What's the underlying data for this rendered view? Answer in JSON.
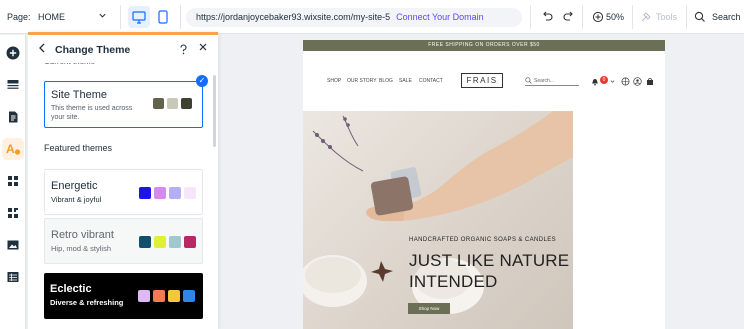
{
  "topbar": {
    "page_label": "Page:",
    "page_value": "HOME",
    "url": "https://jordanjoycebaker93.wixsite.com/my-site-5",
    "connect_domain": "Connect Your Domain",
    "zoom": "50%",
    "tools": "Tools",
    "search": "Search"
  },
  "rail": {
    "items": [
      "add-icon",
      "sections-icon",
      "pages-icon",
      "theme-icon",
      "apps-icon",
      "app-market-icon",
      "media-icon",
      "table-icon"
    ],
    "active_index": 3
  },
  "panel": {
    "title": "Change Theme",
    "current_label": "Current theme",
    "site_theme": {
      "name": "Site Theme",
      "description": "This theme is used across your site.",
      "colors": [
        "#62634c",
        "#c9c9b8",
        "#3d4330"
      ]
    },
    "featured_label": "Featured themes",
    "themes": [
      {
        "name": "Energetic",
        "description": "Vibrant & joyful",
        "colors": [
          "#1f14e8",
          "#d889f0",
          "#b4aef5",
          "#f7e6f9"
        ],
        "bg": "#ffffff",
        "fg": "#20303c"
      },
      {
        "name": "Retro vibrant",
        "description": "Hip, mod & stylish",
        "colors": [
          "#10506a",
          "#dff037",
          "#9fc8cf",
          "#b72864"
        ],
        "bg": "#f6f8f7",
        "fg": "#5f6770"
      },
      {
        "name": "Eclectic",
        "description": "Diverse & refreshing",
        "colors": [
          "#e0b8f4",
          "#f37a54",
          "#f3c93a",
          "#2e87e8"
        ],
        "bg": "#000000",
        "fg": "#ffffff"
      }
    ]
  },
  "site": {
    "shipping_banner": "FREE SHIPPING ON ORDERS OVER $50",
    "nav": [
      "SHOP",
      "OUR STORY",
      "BLOG",
      "SALE",
      "CONTACT"
    ],
    "logo": "FRAIS",
    "search_placeholder": "Search...",
    "cart_count": "0",
    "hero_subtitle": "HANDCRAFTED ORGANIC SOAPS & CANDLES",
    "hero_title": "JUST LIKE NATURE INTENDED",
    "shop_button": "Shop Now"
  },
  "colors": {
    "accent": "#116dff",
    "brand_purple": "#5a48f5",
    "panel_top": "#f7a54a",
    "site_olive": "#6a6f55"
  }
}
